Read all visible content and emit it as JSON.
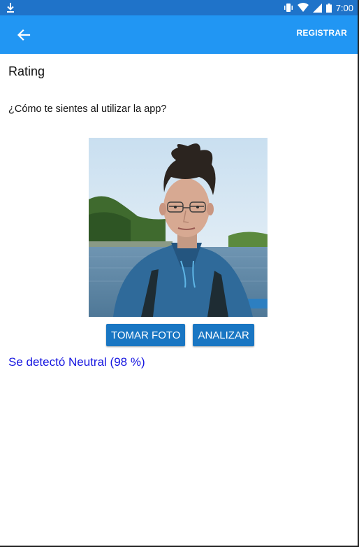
{
  "status_bar": {
    "time": "7:00",
    "icons": [
      "download-icon",
      "vibrate-icon",
      "wifi-icon",
      "signal-icon",
      "battery-icon"
    ]
  },
  "app_bar": {
    "back_icon": "arrow-back-icon",
    "action_label": "REGISTRAR"
  },
  "page": {
    "title": "Rating",
    "question": "¿Cómo te sientes al utilizar la app?"
  },
  "buttons": {
    "take_photo": "TOMAR FOTO",
    "analyze": "ANALIZAR"
  },
  "result": {
    "text": "Se detectó Neutral (98 %)"
  },
  "colors": {
    "status_bar": "#1f73c9",
    "app_bar": "#2196f3",
    "button": "#1976c3",
    "result_text": "#1515e0"
  }
}
